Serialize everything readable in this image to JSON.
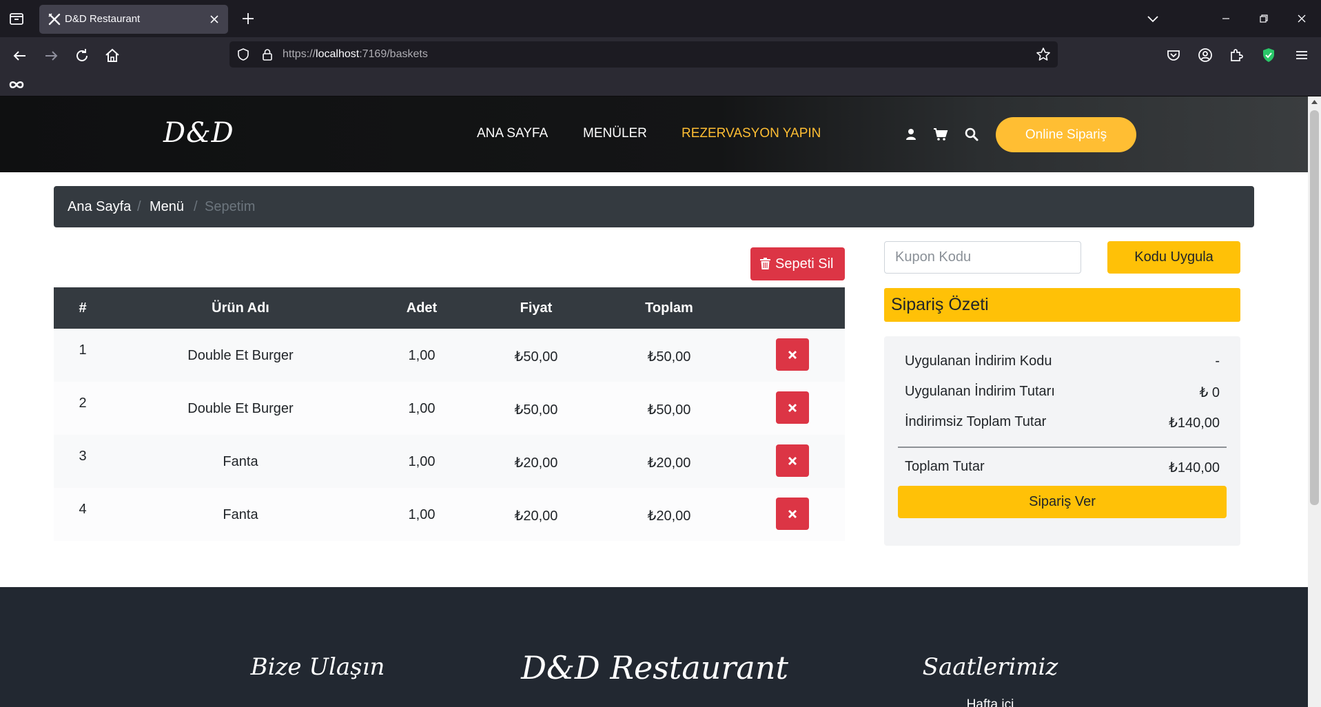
{
  "browser": {
    "tab_title": "D&D Restaurant",
    "url_prefix": "https://",
    "url_host": "localhost",
    "url_rest": ":7169/baskets"
  },
  "header": {
    "brand": "D&D",
    "nav": [
      "ANA SAYFA",
      "MENÜLER",
      "REZERVASYON YAPIN"
    ],
    "active_nav": "REZERVASYON YAPIN",
    "order_button": "Online Sipariş",
    "accent_color": "#ffbe33"
  },
  "breadcrumb": {
    "items": [
      "Ana Sayfa",
      "Menü"
    ],
    "current": "Sepetim",
    "separator": "/"
  },
  "cart": {
    "clear_button": "Sepeti Sil",
    "columns": [
      "#",
      "Ürün Adı",
      "Adet",
      "Fiyat",
      "Toplam"
    ],
    "rows": [
      {
        "no": "1",
        "name": "Double Et Burger",
        "qty": "1,00",
        "price": "₺50,00",
        "total": "₺50,00"
      },
      {
        "no": "2",
        "name": "Double Et Burger",
        "qty": "1,00",
        "price": "₺50,00",
        "total": "₺50,00"
      },
      {
        "no": "3",
        "name": "Fanta",
        "qty": "1,00",
        "price": "₺20,00",
        "total": "₺20,00"
      },
      {
        "no": "4",
        "name": "Fanta",
        "qty": "1,00",
        "price": "₺20,00",
        "total": "₺20,00"
      }
    ],
    "danger_color": "#dc3545"
  },
  "coupon": {
    "placeholder": "Kupon Kodu",
    "value": "",
    "apply_button": "Kodu Uygula"
  },
  "summary": {
    "title": "Sipariş Özeti",
    "discount_code_label": "Uygulanan İndirim Kodu",
    "discount_code_value": "-",
    "discount_amount_label": "Uygulanan İndirim Tutarı",
    "discount_amount_value": "₺ 0",
    "subtotal_label": "İndirimsiz Toplam Tutar",
    "subtotal_value": "₺140,00",
    "total_label": "Toplam Tutar",
    "total_value": "₺140,00",
    "place_order_button": "Sipariş Ver",
    "highlight_color": "#ffc107"
  },
  "footer": {
    "contact_heading": "Bize Ulaşın",
    "brand_heading": "D&D Restaurant",
    "hours_heading": "Saatlerimiz",
    "hours_sub": "Hafta içi"
  }
}
